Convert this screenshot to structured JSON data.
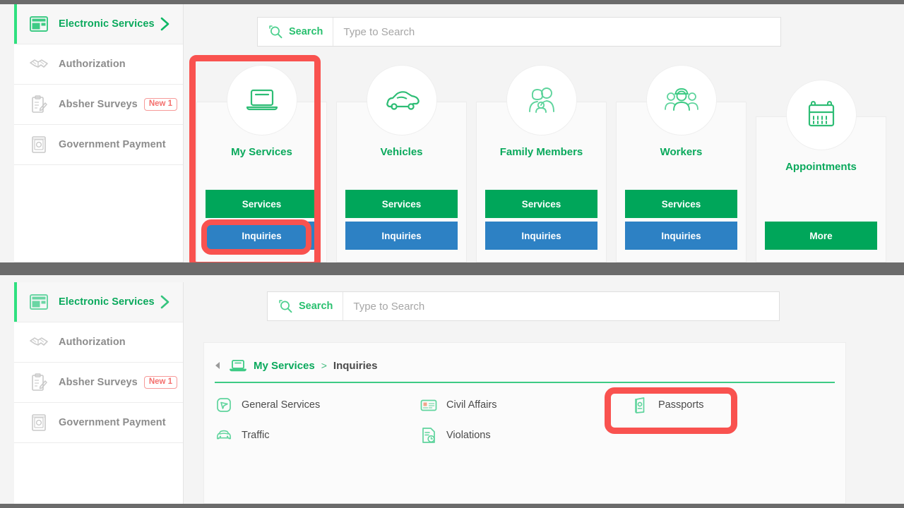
{
  "colors": {
    "green": "#00a65a",
    "green_text": "#0aa95c",
    "blue": "#2d81c4",
    "accent_bar": "#2ee07f",
    "highlight_red": "#f9524f",
    "frame_gray": "#6b6b6b",
    "badge_red": "#f4706e"
  },
  "sidebar": {
    "items": [
      {
        "label": "Electronic Services",
        "icon": "window-layout-icon",
        "active": true,
        "chevron": "chevron-right-icon"
      },
      {
        "label": "Authorization",
        "icon": "handshake-icon",
        "active": false
      },
      {
        "label": "Absher Surveys",
        "icon": "clipboard-pencil-icon",
        "active": false,
        "badge": "New 1"
      },
      {
        "label": "Government Payment",
        "icon": "atm-cash-icon",
        "active": false
      }
    ]
  },
  "search": {
    "label": "Search",
    "placeholder": "Type to Search",
    "value": "",
    "icon": "magnifier-icon"
  },
  "cards": [
    {
      "title": "My Services",
      "icon": "laptop-icon",
      "buttons": [
        {
          "label": "Services",
          "style": "green"
        },
        {
          "label": "Inquiries",
          "style": "blue"
        }
      ]
    },
    {
      "title": "Vehicles",
      "icon": "car-icon",
      "buttons": [
        {
          "label": "Services",
          "style": "green"
        },
        {
          "label": "Inquiries",
          "style": "blue"
        }
      ]
    },
    {
      "title": "Family Members",
      "icon": "family-icon",
      "buttons": [
        {
          "label": "Services",
          "style": "green"
        },
        {
          "label": "Inquiries",
          "style": "blue"
        }
      ]
    },
    {
      "title": "Workers",
      "icon": "workers-icon",
      "buttons": [
        {
          "label": "Services",
          "style": "green"
        },
        {
          "label": "Inquiries",
          "style": "blue"
        }
      ]
    },
    {
      "title": "Appointments",
      "icon": "calendar-icon",
      "buttons": [
        {
          "label": "More",
          "style": "green"
        }
      ]
    }
  ],
  "content": {
    "breadcrumb": {
      "back_icon": "back-arrow-icon",
      "root_icon": "laptop-icon",
      "root": "My Services",
      "separator": ">",
      "current": "Inquiries"
    },
    "inquiry_items": [
      {
        "label": "General Services",
        "icon": "location-pin-icon"
      },
      {
        "label": "Civil Affairs",
        "icon": "id-card-icon"
      },
      {
        "label": "Passports",
        "icon": "passport-icon"
      },
      {
        "label": "Traffic",
        "icon": "car-front-icon"
      },
      {
        "label": "Violations",
        "icon": "violation-doc-icon"
      }
    ]
  },
  "highlights": [
    {
      "name": "my-services-card-highlight",
      "target": "My Services"
    },
    {
      "name": "inquiries-button-highlight",
      "target": "Inquiries"
    },
    {
      "name": "passports-highlight",
      "target": "Passports"
    }
  ]
}
